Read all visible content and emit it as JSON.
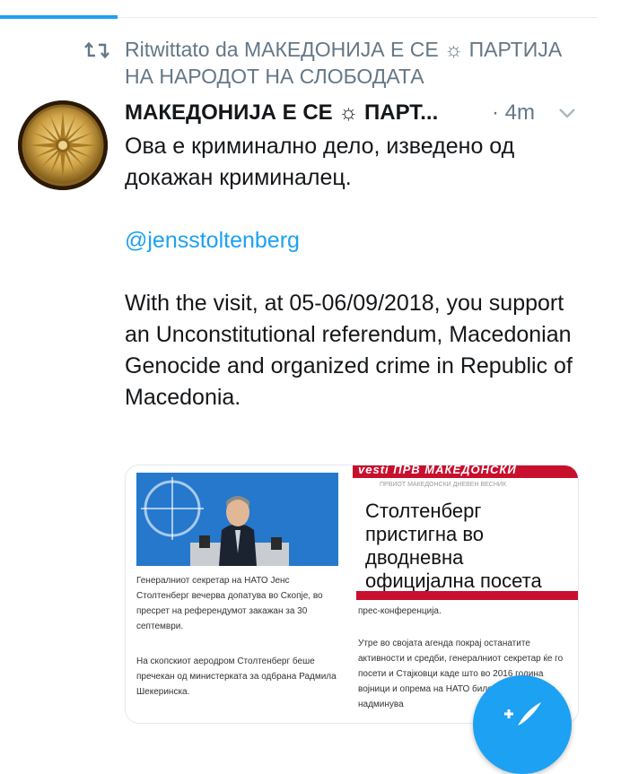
{
  "tabbar": {
    "active_tab": "home"
  },
  "retweet": {
    "icon": "retweet-icon",
    "text": "Ritwittato da МАКЕДОНИЈА Е СЕ ☼ ПАРТИЈА НА НАРОДОТ НА СЛОБОДАТА"
  },
  "tweet": {
    "author": "МАКЕДОНИЈА Е СЕ ☼ ПАРТ...",
    "time": "· 4m",
    "line1": "Ова е криминално дело, изведено од докажан криминалец.",
    "mention": "@jensstoltenberg",
    "line2": "With the visit, at 05-06/09/2018, you support an Unconstitutional referendum, Macedonian Genocide and organized crime  in Republic of Macedonia."
  },
  "media": {
    "left": {
      "p1": "Генералниот секретар на НАТО Јенс Столтенберг вечерва допатува во Скопје, во пресрет на референдумот закажан за 30 септември.",
      "p2": "На скопскиот аеродром Столтенберг беше пречекан од министерката за одбрана Радмила Шекеринска."
    },
    "right": {
      "masthead": "vesti ПРВ МАКЕДОНСКИ",
      "masthead_sub": "ПРВИОТ МАКЕДОНСКИ ДНЕВЕН ВЕСНИК",
      "headline": "Столтенберг пристигна во дводневна официјална посета",
      "p1": "прес-конференција.",
      "p2": "Утре во својата агенда покрај останатите активности и средби, генералниот секретар ќе го посети и Стајковци каде што во 2016 година војници и опрема на НАТО биле ангажирани за надминува"
    }
  },
  "fab": {
    "icon": "compose-tweet-icon"
  },
  "colors": {
    "accent": "#1da1f2",
    "muted": "#657786",
    "text": "#14171a"
  }
}
